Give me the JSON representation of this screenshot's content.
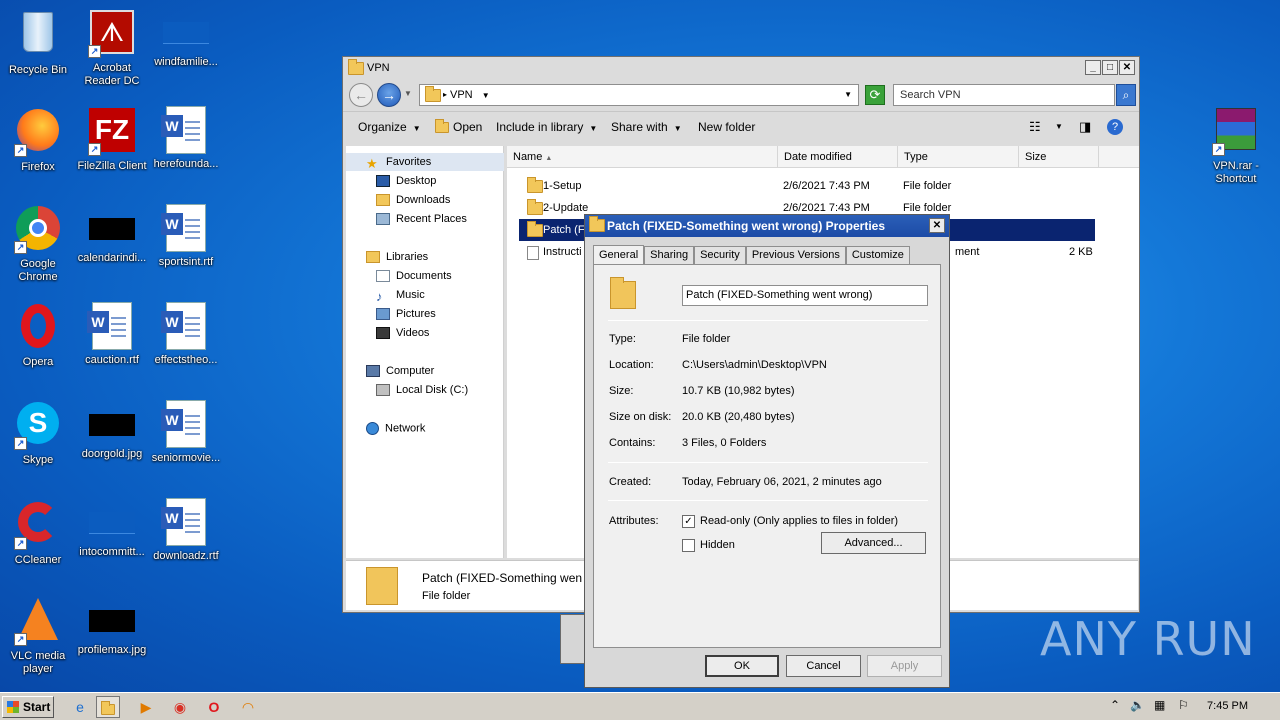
{
  "desktop": {
    "icons": [
      {
        "label": "Recycle Bin"
      },
      {
        "label": "Acrobat Reader DC"
      },
      {
        "label": "windfamilie..."
      },
      {
        "label": "Firefox"
      },
      {
        "label": "FileZilla Client"
      },
      {
        "label": "herefounda..."
      },
      {
        "label": "Google Chrome"
      },
      {
        "label": "calendarindi..."
      },
      {
        "label": "sportsint.rtf"
      },
      {
        "label": "Opera"
      },
      {
        "label": "cauction.rtf"
      },
      {
        "label": "effectstheo..."
      },
      {
        "label": "Skype"
      },
      {
        "label": "doorgold.jpg"
      },
      {
        "label": "seniormovie..."
      },
      {
        "label": "CCleaner"
      },
      {
        "label": "intocommitt..."
      },
      {
        "label": "downloadz.rtf"
      },
      {
        "label": "VLC media player"
      },
      {
        "label": "profilemax.jpg"
      },
      {
        "label": "VPN.rar - Shortcut"
      }
    ],
    "watermark": "ANY RUN"
  },
  "explorer": {
    "title": "VPN",
    "address": "VPN",
    "search_placeholder": "Search VPN",
    "toolbar": {
      "organize": "Organize",
      "open": "Open",
      "include": "Include in library",
      "share": "Share with",
      "new_folder": "New folder"
    },
    "nav": {
      "favorites": "Favorites",
      "desktop": "Desktop",
      "downloads": "Downloads",
      "recent": "Recent Places",
      "libraries": "Libraries",
      "documents": "Documents",
      "music": "Music",
      "pictures": "Pictures",
      "videos": "Videos",
      "computer": "Computer",
      "local_disk": "Local Disk (C:)",
      "network": "Network"
    },
    "columns": {
      "name": "Name",
      "date": "Date modified",
      "type": "Type",
      "size": "Size"
    },
    "rows": [
      {
        "name": "1-Setup",
        "date": "2/6/2021 7:43 PM",
        "type": "File folder",
        "size": ""
      },
      {
        "name": "2-Update",
        "date": "2/6/2021 7:43 PM",
        "type": "File folder",
        "size": ""
      },
      {
        "name": "Patch (FI",
        "date": "",
        "type": "",
        "size": ""
      },
      {
        "name": "Instructi",
        "date": "",
        "type": "ment",
        "size": "2 KB"
      }
    ],
    "details": {
      "name": "Patch (FIXED-Something wen",
      "type": "File folder"
    }
  },
  "properties": {
    "title": "Patch (FIXED-Something went wrong) Properties",
    "tabs": [
      "General",
      "Sharing",
      "Security",
      "Previous Versions",
      "Customize"
    ],
    "name_value": "Patch (FIXED-Something went wrong)",
    "type_label": "Type:",
    "type_value": "File folder",
    "location_label": "Location:",
    "location_value": "C:\\Users\\admin\\Desktop\\VPN",
    "size_label": "Size:",
    "size_value": "10.7 KB (10,982 bytes)",
    "size_disk_label": "Size on disk:",
    "size_disk_value": "20.0 KB (20,480 bytes)",
    "contains_label": "Contains:",
    "contains_value": "3 Files, 0 Folders",
    "created_label": "Created:",
    "created_value": "Today, February 06, 2021, 2 minutes ago",
    "attributes_label": "Attributes:",
    "readonly_label": "Read-only (Only applies to files in folder)",
    "hidden_label": "Hidden",
    "advanced_button": "Advanced...",
    "ok_button": "OK",
    "cancel_button": "Cancel",
    "apply_button": "Apply"
  },
  "taskbar": {
    "start": "Start",
    "clock": "7:45 PM"
  }
}
